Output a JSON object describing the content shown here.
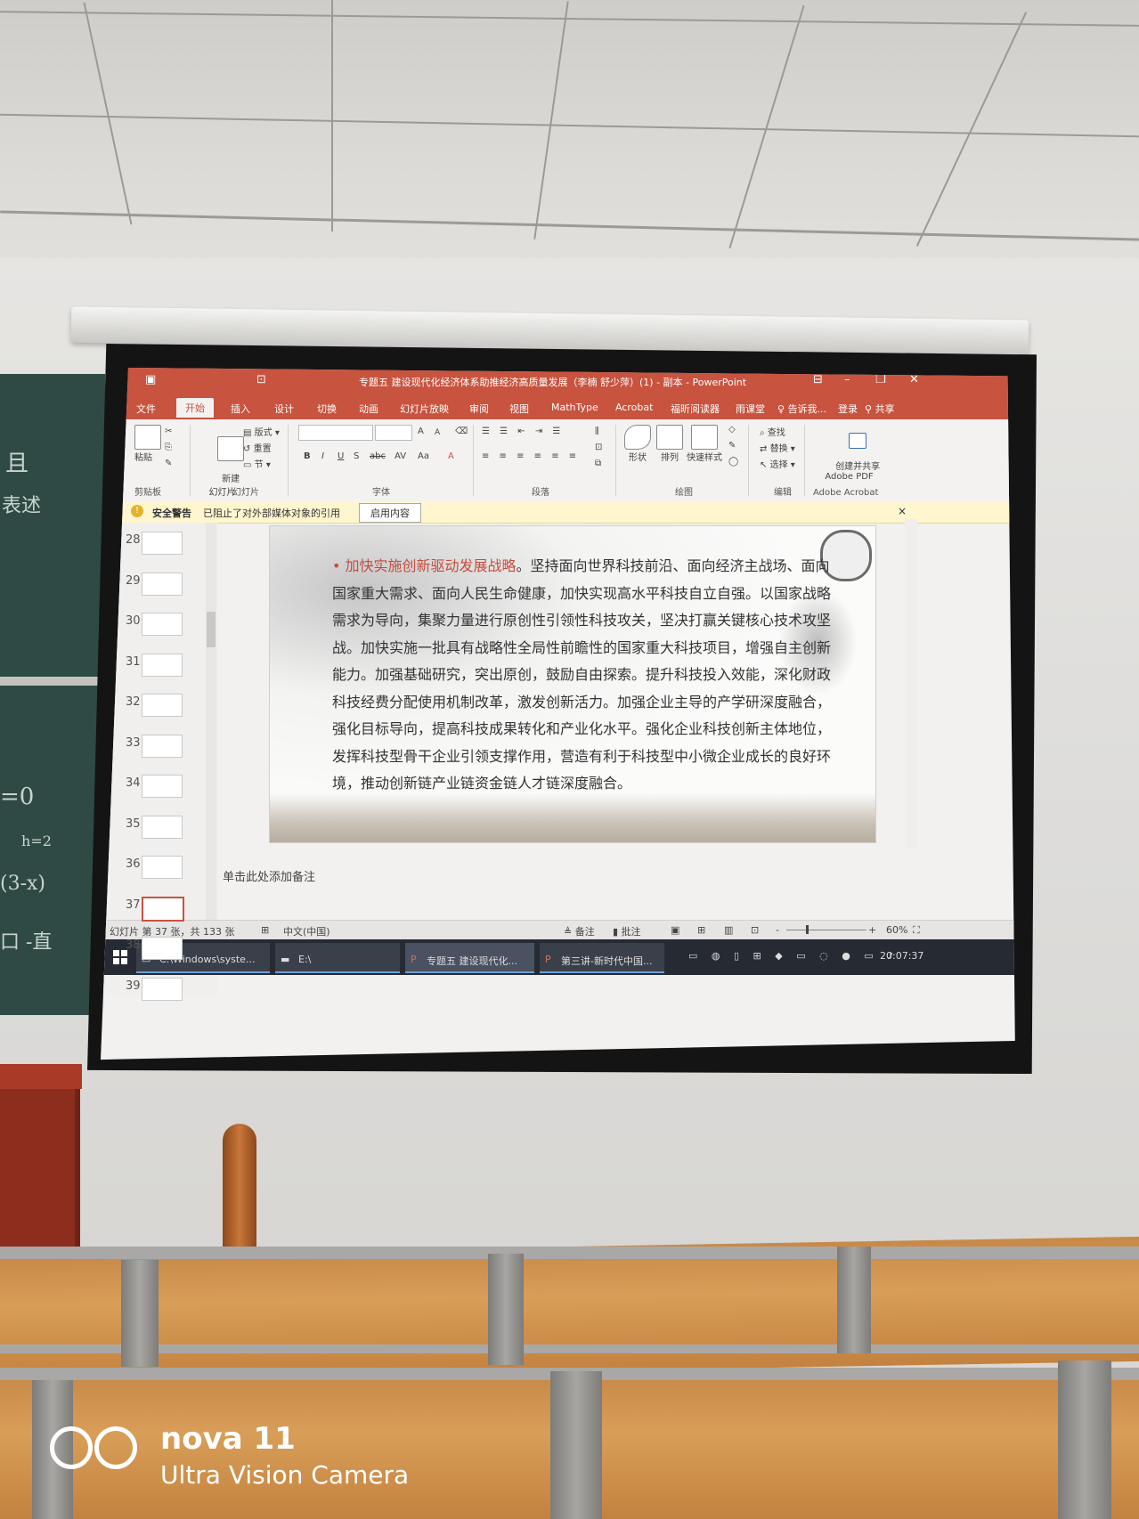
{
  "window": {
    "title": "专题五 建设现代化经济体系助推经济高质量发展（李楠 舒少萍）(1) - 副本 - PowerPoint",
    "minimize": "–",
    "restore": "❐",
    "close": "✕"
  },
  "menu": {
    "file": "文件",
    "home": "开始",
    "insert": "插入",
    "design": "设计",
    "transitions": "切换",
    "animations": "动画",
    "slideshow": "幻灯片放映",
    "review": "审阅",
    "view": "视图",
    "mathtype": "MathType",
    "acrobat": "Acrobat",
    "reader": "福昕阅读器",
    "rain": "雨课堂",
    "tellme": "告诉我...",
    "signin": "登录",
    "share": "共享"
  },
  "ribbon": {
    "paste": "粘贴",
    "clipboard": "剪贴板",
    "new_slide": "新建\n幻灯片",
    "layout": "版式",
    "reset": "重置",
    "section": "节",
    "slides_group": "幻灯片",
    "font_group": "字体",
    "paragraph_group": "段落",
    "shapes": "形状",
    "arrange": "排列",
    "quick_styles": "快速样式",
    "drawing_group": "绘图",
    "find": "查找",
    "replace": "替换",
    "select": "选择",
    "editing_group": "编辑",
    "create_pdf": "创建并共享\nAdobe PDF",
    "adobe_group": "Adobe Acrobat",
    "bold": "B",
    "italic": "I",
    "underline": "U",
    "strike": "S",
    "abc": "abc",
    "av": "AV",
    "aa": "Aa",
    "a_big": "A",
    "a_small": "A"
  },
  "security_bar": {
    "label": "安全警告",
    "message": "已阻止了对外部媒体对象的引用",
    "button": "启用内容"
  },
  "thumbnails": [
    "28",
    "29",
    "30",
    "31",
    "32",
    "33",
    "34",
    "35",
    "36",
    "37",
    "38",
    "39"
  ],
  "selected_slide": "37",
  "slide": {
    "heading": "加快实施创新驱动发展战略",
    "body": "。坚持面向世界科技前沿、面向经济主战场、面向国家重大需求、面向人民生命健康，加快实现高水平科技自立自强。以国家战略需求为导向，集聚力量进行原创性引领性科技攻关，坚决打赢关键核心技术攻坚战。加快实施一批具有战略性全局性前瞻性的国家重大科技项目，增强自主创新能力。加强基础研究，突出原创，鼓励自由探索。提升科技投入效能，深化财政科技经费分配使用机制改革，激发创新活力。加强企业主导的产学研深度融合，强化目标导向，提高科技成果转化和产业化水平。强化企业科技创新主体地位，发挥科技型骨干企业引领支撑作用，营造有利于科技型中小微企业成长的良好环境，推动创新链产业链资金链人才链深度融合。"
  },
  "notes_placeholder": "单击此处添加备注",
  "status": {
    "slide_info": "幻灯片 第 37 张，共 133 张",
    "language": "中文(中国)",
    "notes": "备注",
    "comments": "批注",
    "zoom": "60%",
    "minus": "-",
    "plus": "+"
  },
  "taskbar": {
    "cmd": "C:\\Windows\\syste...",
    "explorer": "E:\\",
    "ppt1": "专题五 建设现代化...",
    "ppt2": "第三讲-新时代中国...",
    "time": "20:07:37"
  },
  "watermark": {
    "brand": "nova 11",
    "camera": "Ultra Vision Camera"
  },
  "colors": {
    "ppt_accent": "#c8533f",
    "slide_heading": "#c44d3e"
  }
}
